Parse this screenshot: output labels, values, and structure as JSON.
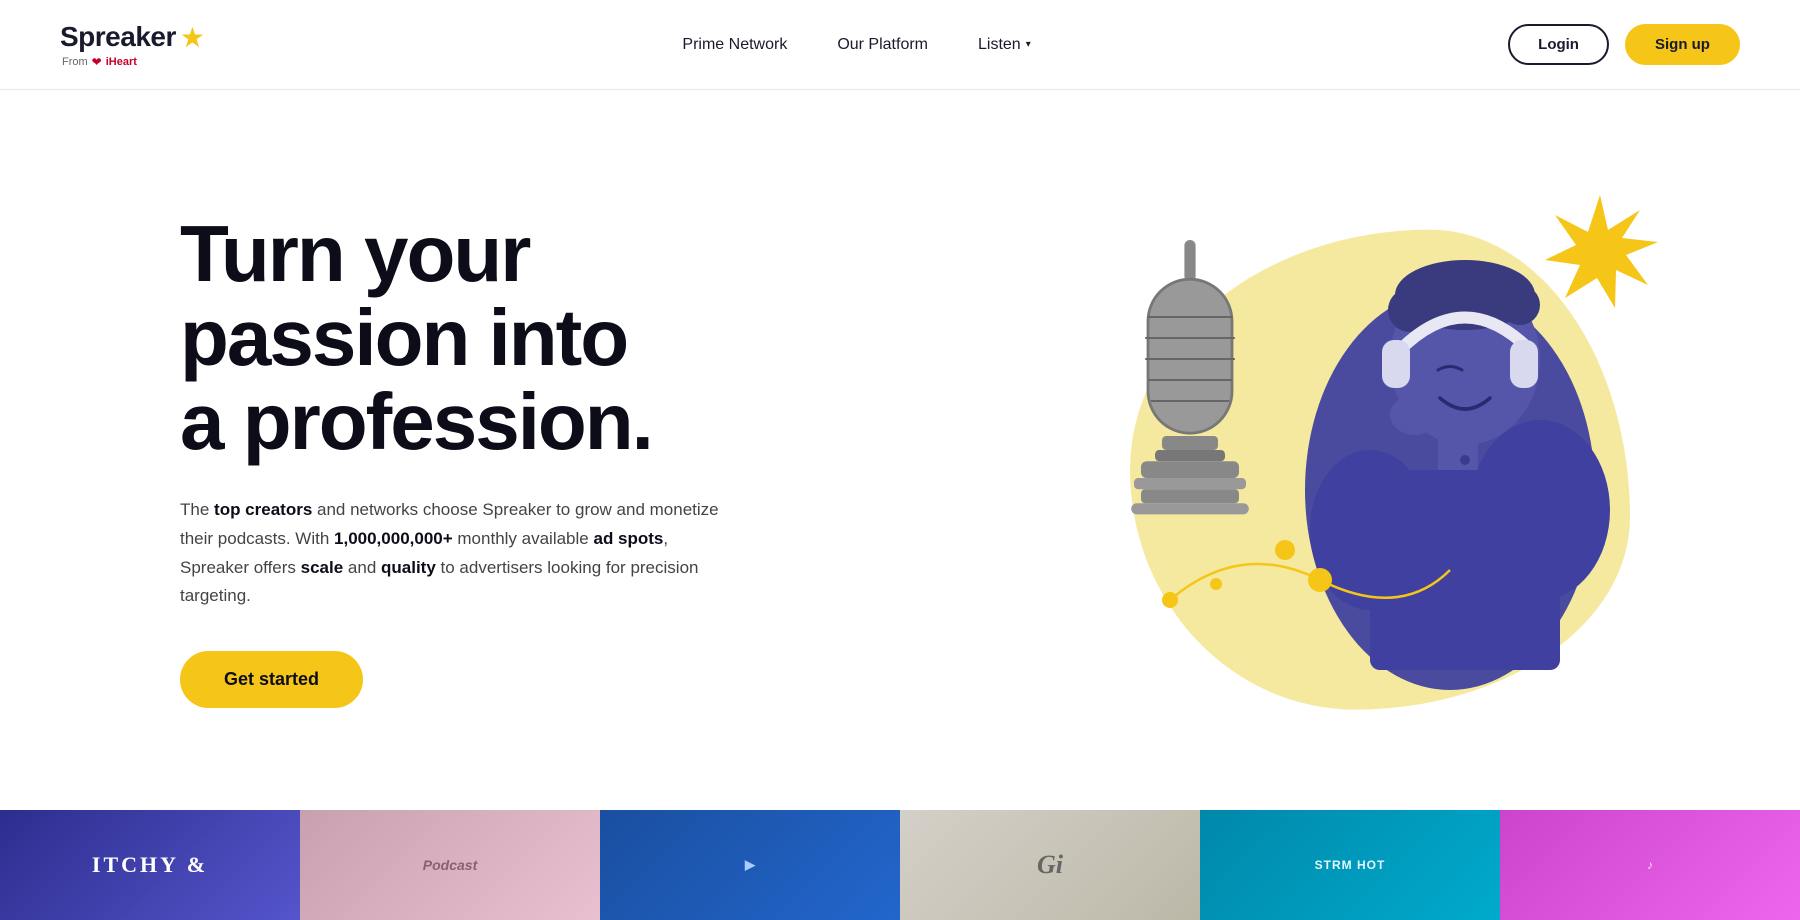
{
  "navbar": {
    "logo": {
      "text": "Spreaker",
      "star": "★",
      "from_text": "From",
      "iheart_text": "iHeart"
    },
    "nav_links": [
      {
        "id": "prime-network",
        "label": "Prime Network"
      },
      {
        "id": "our-platform",
        "label": "Our Platform"
      },
      {
        "id": "listen",
        "label": "Listen",
        "has_dropdown": true
      }
    ],
    "login_label": "Login",
    "signup_label": "Sign up"
  },
  "hero": {
    "title_line1": "Turn your",
    "title_line2": "passion into",
    "title_line3": "a profession.",
    "description_pre": "The ",
    "description_bold1": "top creators",
    "description_mid1": " and networks choose Spreaker to grow and monetize their podcasts. With ",
    "description_bold2": "1,000,000,000+",
    "description_mid2": " monthly available ",
    "description_bold3": "ad spots",
    "description_mid3": ", Spreaker offers ",
    "description_bold4": "scale",
    "description_mid4": " and ",
    "description_bold5": "quality",
    "description_end": " to advertisers looking for precision targeting.",
    "cta_label": "Get started"
  },
  "podcast_strip": [
    {
      "id": "card-1",
      "label": "ITCHY &",
      "bg": "#2d2d8e"
    },
    {
      "id": "card-2",
      "label": "",
      "bg": "#c8a0b0"
    },
    {
      "id": "card-3",
      "label": "",
      "bg": "#1a4fa0"
    },
    {
      "id": "card-4",
      "label": "",
      "bg": "#d4d0c8"
    },
    {
      "id": "card-5",
      "label": "STRM HOT",
      "bg": "#0088aa"
    },
    {
      "id": "card-6",
      "label": "",
      "bg": "#cc44cc"
    }
  ],
  "colors": {
    "yellow": "#f5c518",
    "dark": "#0d0d1a",
    "purple": "#4a4a9e",
    "light_yellow_blob": "#f5e9a0"
  }
}
